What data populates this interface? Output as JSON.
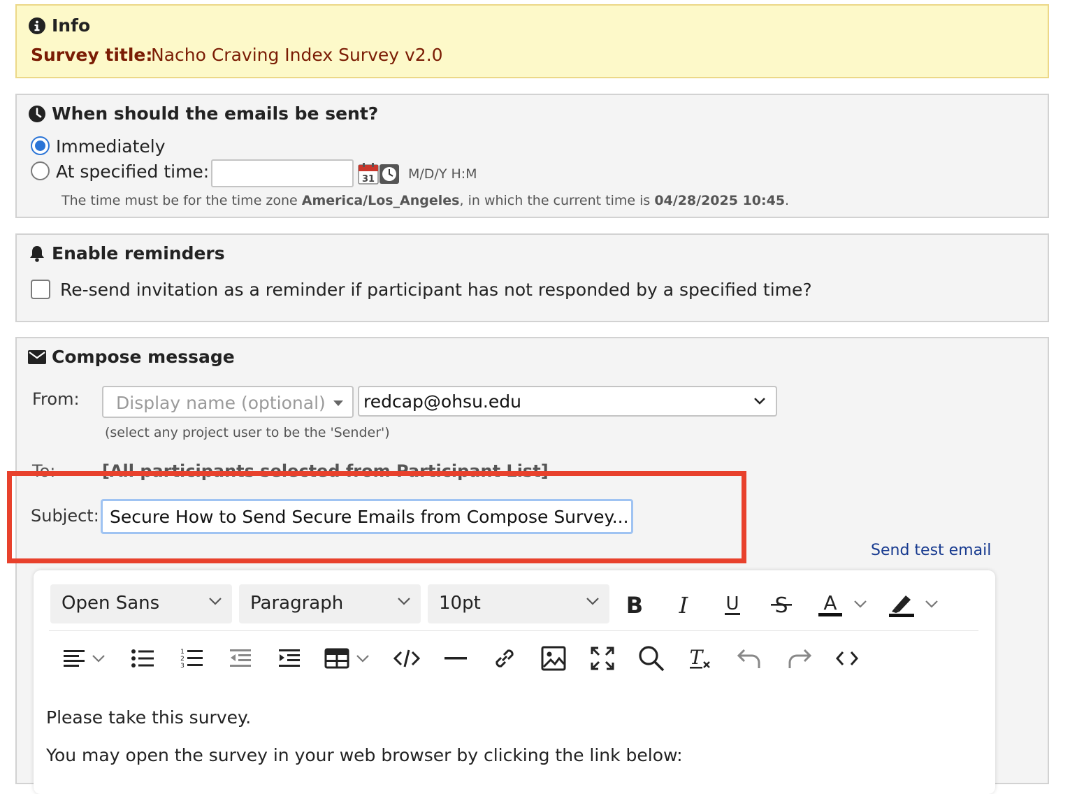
{
  "info": {
    "title": "Info",
    "survey_label": "Survey title:",
    "survey_value": "Nacho Craving Index Survey v2.0"
  },
  "when": {
    "title": "When should the emails be sent?",
    "immediately": "Immediately",
    "specified": "At specified time:",
    "datetime_value": "",
    "format_hint": "M/D/Y H:M",
    "note_prefix": "The time must be for the time zone ",
    "timezone": "America/Los_Angeles",
    "note_middle": ", in which the current time is ",
    "current_time": "04/28/2025 10:45",
    "note_suffix": "."
  },
  "reminders": {
    "title": "Enable reminders",
    "checkbox_label": "Re-send invitation as a reminder if participant has not responded by a specified time?"
  },
  "compose": {
    "title": "Compose message",
    "from_label": "From:",
    "display_name_placeholder": "Display name (optional)",
    "from_email": "redcap@ohsu.edu",
    "sender_hint": "(select any project user to be the 'Sender')",
    "to_label": "To:",
    "to_value": "[All participants selected from Participant List]",
    "subject_label": "Subject:",
    "subject_value": "Secure How to Send Secure Emails from Compose Survey...",
    "send_test": "Send test email"
  },
  "editor": {
    "font": "Open Sans",
    "block": "Paragraph",
    "size": "10pt",
    "body_line1": "Please take this survey.",
    "body_line2": "You may open the survey in your web browser by clicking the link below:"
  },
  "colors": {
    "accent": "#2a74d6",
    "highlight": "#e8412c",
    "info_text": "#7a1c04",
    "link": "#173a8f"
  }
}
